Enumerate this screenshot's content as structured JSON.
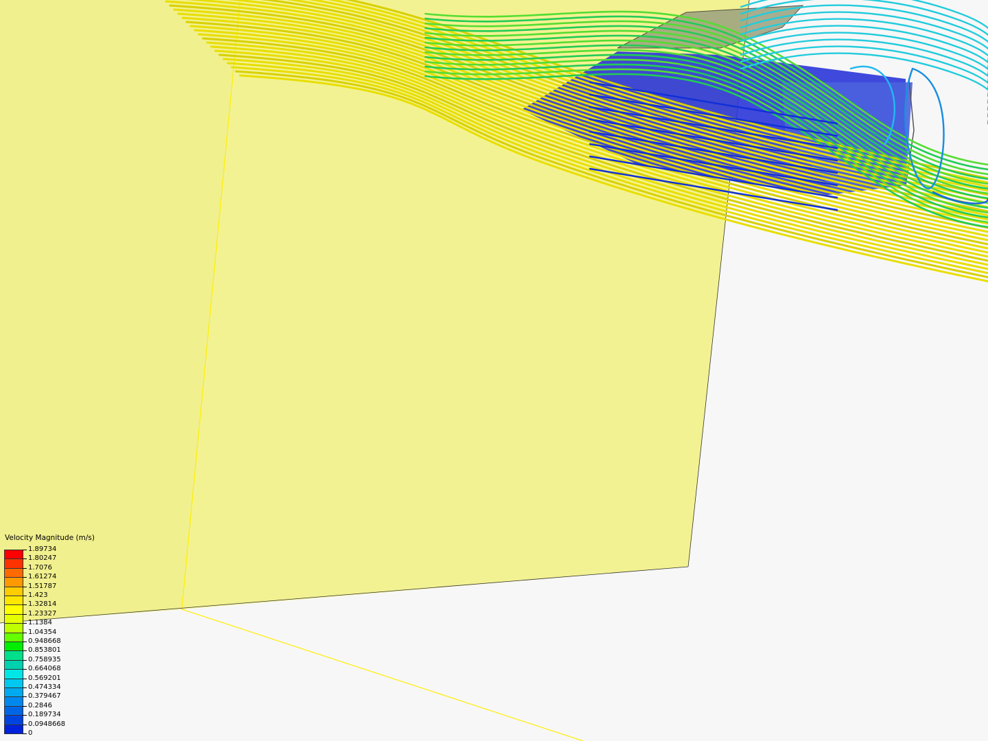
{
  "legend": {
    "title": "Velocity Magnitude (m/s)",
    "labels": [
      "1.89734",
      "1.80247",
      "1.7076",
      "1.61274",
      "1.51787",
      "1.423",
      "1.32814",
      "1.23327",
      "1.1384",
      "1.04354",
      "0.948668",
      "0.853801",
      "0.758935",
      "0.664068",
      "0.569201",
      "0.474334",
      "0.379467",
      "0.2846",
      "0.189734",
      "0.0948668",
      "0"
    ],
    "colors": [
      "#ff0000",
      "#ff3300",
      "#ff6a00",
      "#ff9900",
      "#ffcc00",
      "#ffe600",
      "#ffff00",
      "#e6ff00",
      "#bfff00",
      "#66ff00",
      "#00ee00",
      "#00e08a",
      "#00d2b0",
      "#00e6e6",
      "#00c8f0",
      "#00aaf0",
      "#0088ee",
      "#0066e6",
      "#0044e0",
      "#0022dd",
      "#0000dd"
    ]
  },
  "colors": {
    "background": "#f7f7f7",
    "domain_face": "#f3f290",
    "domain_edge": "#ffee00",
    "streamline_fast": "#e8de00",
    "streamline_mid": "#22cc55",
    "streamline_slow": "#22ccdd",
    "object_surface": "#2a35d8"
  }
}
